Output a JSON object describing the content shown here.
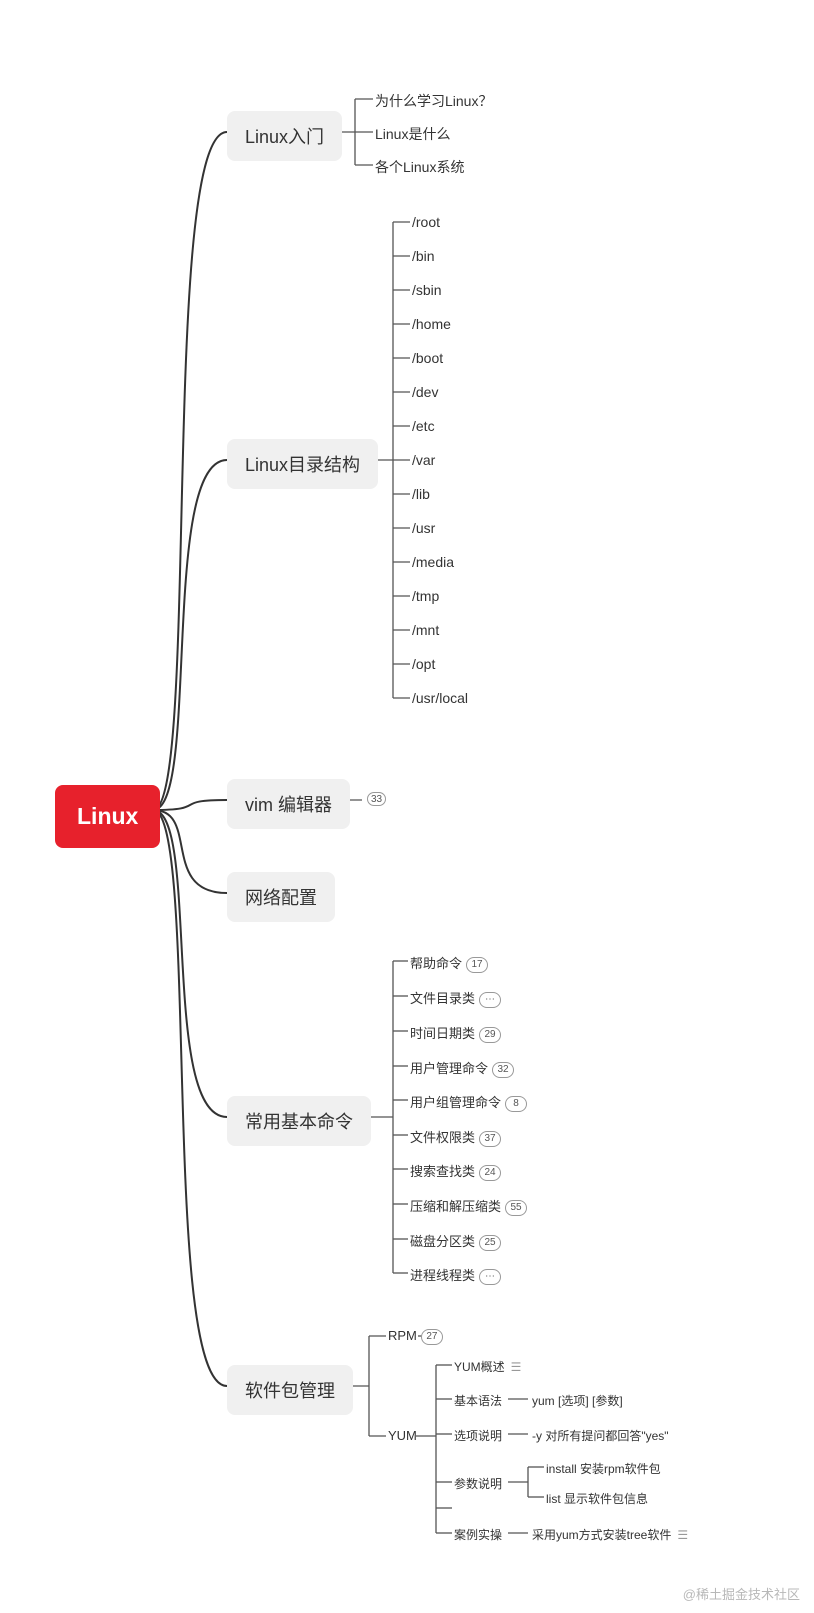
{
  "root": "Linux",
  "branches": [
    {
      "label": "Linux入门",
      "children": [
        "为什么学习Linux？",
        "Linux是什么",
        "各个Linux系统"
      ]
    },
    {
      "label": "Linux目录结构",
      "children": [
        "/root",
        "/bin",
        "/sbin",
        "/home",
        "/boot",
        "/dev",
        "/etc",
        "/var",
        "/lib",
        "/usr",
        "/media",
        "/tmp",
        "/mnt",
        "/opt",
        "/usr/local"
      ]
    },
    {
      "label": "vim 编辑器",
      "count": "33"
    },
    {
      "label": "网络配置"
    },
    {
      "label": "常用基本命令",
      "children": [
        {
          "label": "帮助命令",
          "count": "17"
        },
        {
          "label": "文件目录类",
          "count": "…"
        },
        {
          "label": "时间日期类",
          "count": "29"
        },
        {
          "label": "用户管理命令",
          "count": "32"
        },
        {
          "label": "用户组管理命令",
          "count": "8"
        },
        {
          "label": "文件权限类",
          "count": "37"
        },
        {
          "label": "搜索查找类",
          "count": "24"
        },
        {
          "label": "压缩和解压缩类",
          "count": "55"
        },
        {
          "label": "磁盘分区类",
          "count": "25"
        },
        {
          "label": "进程线程类",
          "count": "…"
        }
      ]
    },
    {
      "label": "软件包管理",
      "children": [
        {
          "label": "RPM",
          "count": "27"
        },
        {
          "label": "YUM",
          "children": [
            {
              "label": "YUM概述"
            },
            {
              "label": "基本语法",
              "detail": "yum [选项] [参数]"
            },
            {
              "label": "选项说明",
              "detail": "-y 对所有提问都回答\"yes\""
            },
            {
              "label": "参数说明",
              "details": [
                "install 安装rpm软件包",
                "list 显示软件包信息"
              ]
            },
            {
              "label": "案例实操",
              "detail": "采用yum方式安装tree软件"
            }
          ]
        }
      ]
    }
  ],
  "watermark": "@稀土掘金技术社区"
}
